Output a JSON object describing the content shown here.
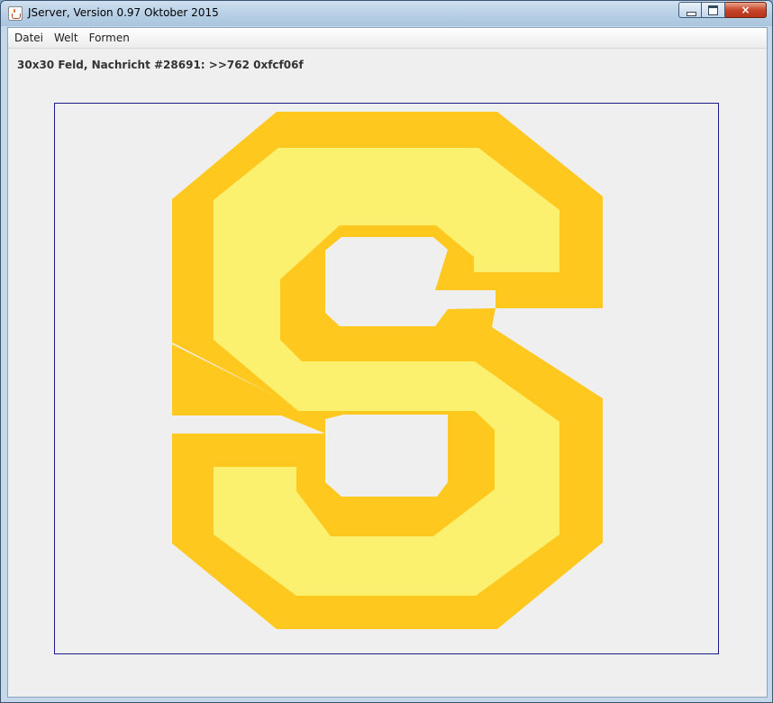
{
  "window": {
    "title": "JServer, Version 0.97 Oktober 2015",
    "icon": "java-cup-icon",
    "buttons": {
      "minimize": "minimize-icon",
      "maximize": "maximize-icon",
      "close": "×"
    }
  },
  "menu": {
    "items": [
      {
        "label": "Datei"
      },
      {
        "label": "Welt"
      },
      {
        "label": "Formen"
      }
    ]
  },
  "status": {
    "text": "30x30 Feld, Nachricht #28691: >>762 0xfcf06f"
  },
  "colors": {
    "outer_ring": "#ffc81e",
    "inner_ring": "#fcf06f",
    "canvas_border": "#1a1a8a",
    "canvas_bg": "#efefef"
  }
}
